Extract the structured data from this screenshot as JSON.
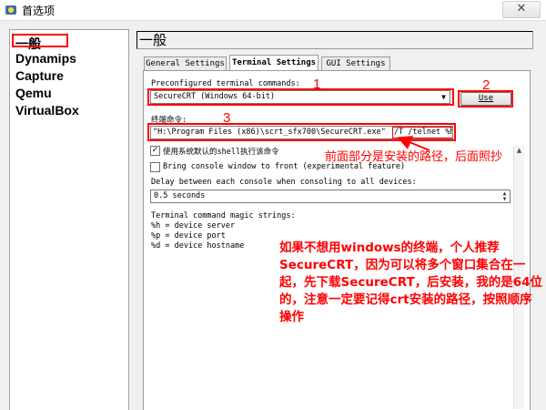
{
  "window": {
    "title": "首选项",
    "close_symbol": "✕",
    "app_icon": "gear-app-icon"
  },
  "sidebar": {
    "items": [
      {
        "label": "一般"
      },
      {
        "label": "Dynamips"
      },
      {
        "label": "Capture"
      },
      {
        "label": "Qemu"
      },
      {
        "label": "VirtualBox"
      }
    ]
  },
  "main": {
    "heading": "一般",
    "tabs": [
      {
        "label": "General Settings"
      },
      {
        "label": "Terminal Settings"
      },
      {
        "label": "GUI Settings"
      }
    ],
    "preconfigured_label": "Preconfigured terminal commands:",
    "preconfigured_value": "SecureCRT (Windows 64-bit)",
    "use_button": "Use",
    "terminal_cmd_label": "终端命令:",
    "terminal_cmd_path": "\"H:\\Program Files (x86)\\scrt_sfx700\\SecureCRT.exe\"",
    "terminal_cmd_args": "/T /telnet %h %p",
    "checkbox_system_shell": "使用系统默认的shell执行该命令",
    "checkbox_system_shell_checked": true,
    "checkbox_front": "Bring console window to front (experimental feature)",
    "checkbox_front_checked": false,
    "delay_label": "Delay between each console when consoling to all devices:",
    "delay_value": "0.5 seconds",
    "magic_title": "Terminal command magic strings:",
    "magic_lines": [
      "%h = device server",
      "%p = device port",
      "%d = device hostname"
    ]
  },
  "annotations": {
    "num1": "1",
    "num2": "2",
    "num3": "3",
    "note_path": "前面部分是安装的路径，后面照抄",
    "note_main": "如果不想用windows的终端，个人推荐SecureCRT，因为可以将多个窗口集合在一起，先下载SecureCRT，后安装，我的是64位的，注意一定要记得crt安装的路径，按照顺序操作",
    "color": "#ff0000"
  }
}
